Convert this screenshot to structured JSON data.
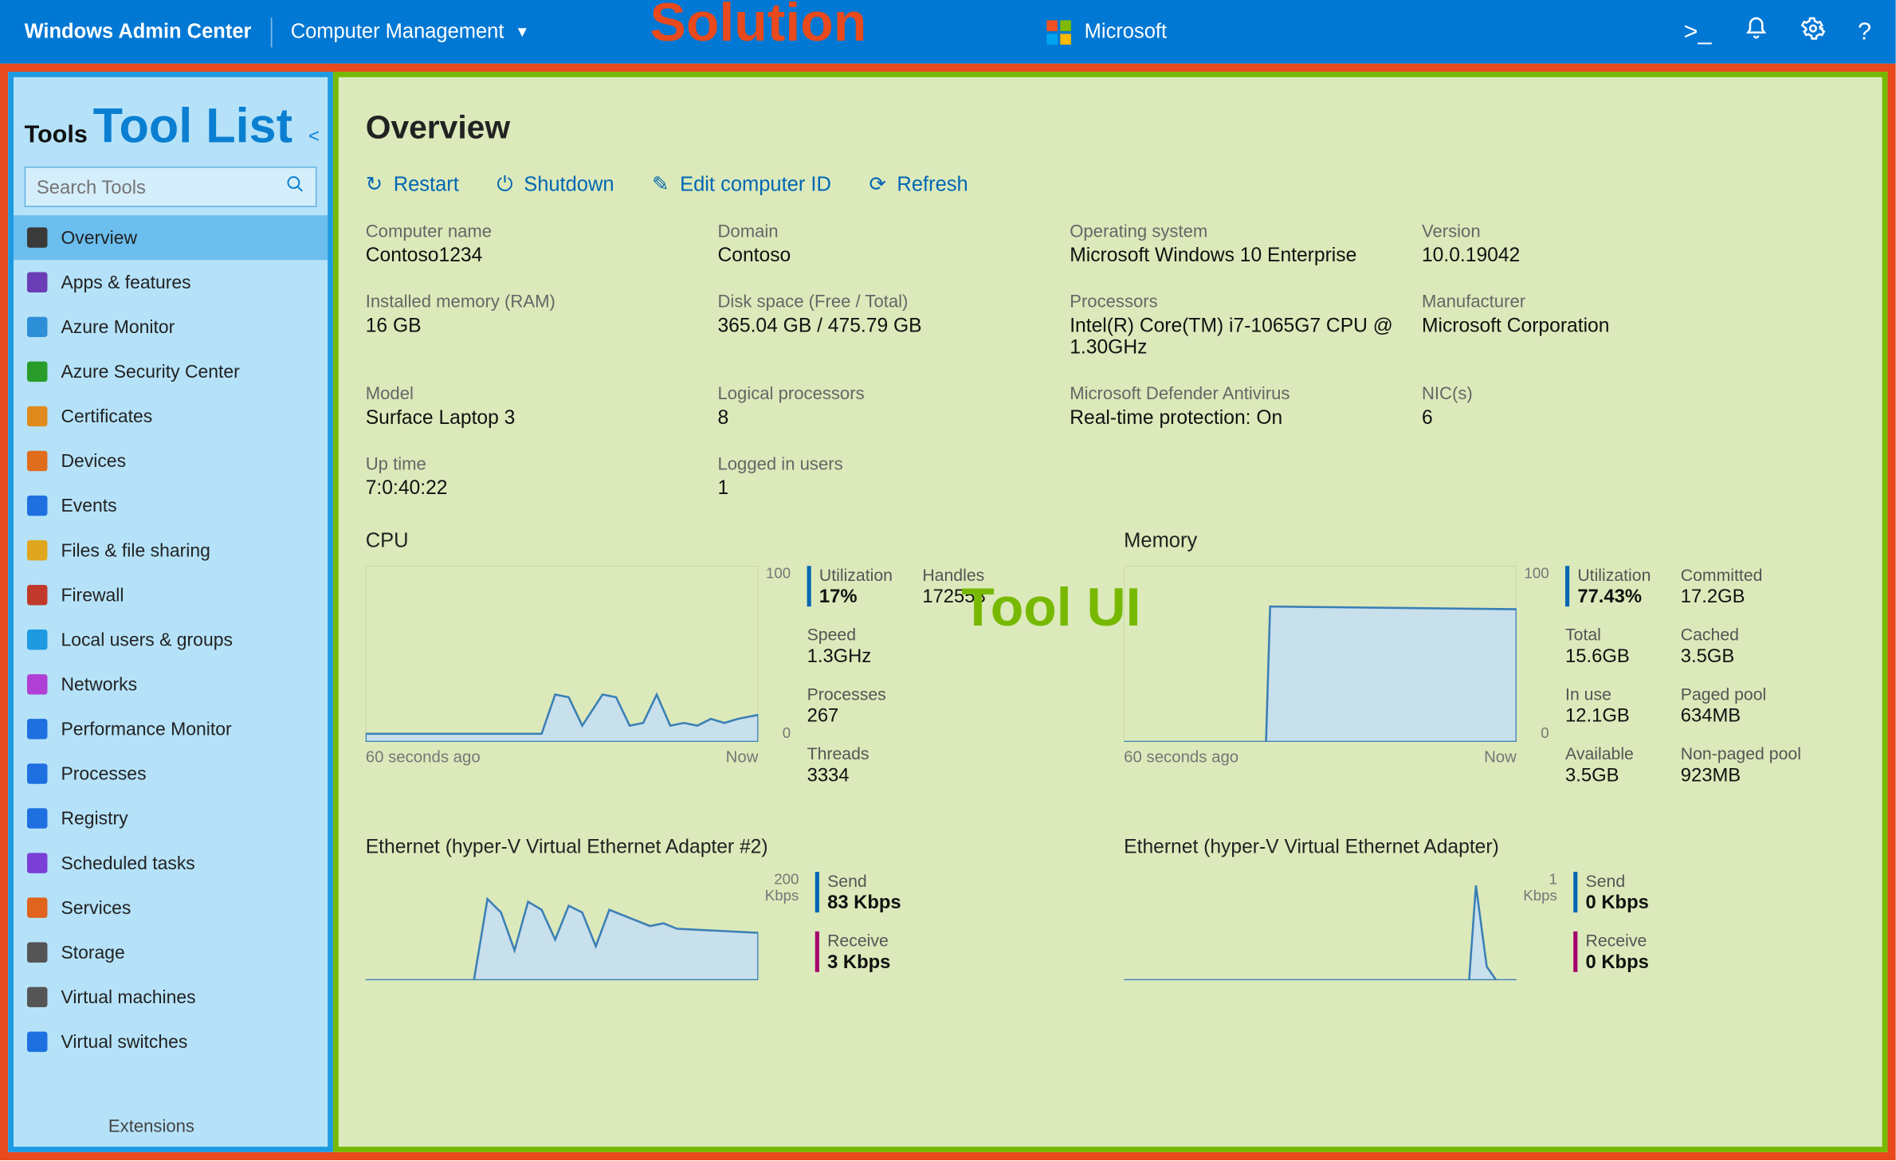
{
  "annotations": {
    "solution_label": "Solution",
    "tool_list_label": "Tool List",
    "tool_ui_label": "Tool UI"
  },
  "topbar": {
    "brand": "Windows Admin Center",
    "solution": "Computer Management",
    "ms_label": "Microsoft"
  },
  "sidebar": {
    "tools_label": "Tools",
    "search_placeholder": "Search Tools",
    "extensions_label": "Extensions",
    "items": [
      {
        "label": "Overview",
        "icon": "#3a3a3a",
        "selected": true
      },
      {
        "label": "Apps & features",
        "icon": "#6a3fb5"
      },
      {
        "label": "Azure Monitor",
        "icon": "#2d8fd6"
      },
      {
        "label": "Azure Security Center",
        "icon": "#2a9c2a"
      },
      {
        "label": "Certificates",
        "icon": "#e08a1e"
      },
      {
        "label": "Devices",
        "icon": "#e06c1e"
      },
      {
        "label": "Events",
        "icon": "#1e70e0"
      },
      {
        "label": "Files & file sharing",
        "icon": "#e0a71e"
      },
      {
        "label": "Firewall",
        "icon": "#c0392b"
      },
      {
        "label": "Local users & groups",
        "icon": "#1e9ae0"
      },
      {
        "label": "Networks",
        "icon": "#b03fd6"
      },
      {
        "label": "Performance Monitor",
        "icon": "#1e70e0"
      },
      {
        "label": "Processes",
        "icon": "#1e70e0"
      },
      {
        "label": "Registry",
        "icon": "#1e70e0"
      },
      {
        "label": "Scheduled tasks",
        "icon": "#7a3fd6"
      },
      {
        "label": "Services",
        "icon": "#e0641e"
      },
      {
        "label": "Storage",
        "icon": "#555"
      },
      {
        "label": "Virtual machines",
        "icon": "#555"
      },
      {
        "label": "Virtual switches",
        "icon": "#1e70e0"
      }
    ]
  },
  "overview": {
    "title": "Overview",
    "actions": {
      "restart": "Restart",
      "shutdown": "Shutdown",
      "edit_id": "Edit computer ID",
      "refresh": "Refresh"
    },
    "fields": {
      "computer_name": {
        "label": "Computer name",
        "value": "Contoso1234"
      },
      "domain": {
        "label": "Domain",
        "value": "Contoso"
      },
      "os": {
        "label": "Operating system",
        "value": "Microsoft Windows 10 Enterprise"
      },
      "version": {
        "label": "Version",
        "value": "10.0.19042"
      },
      "ram": {
        "label": "Installed memory (RAM)",
        "value": "16 GB"
      },
      "disk": {
        "label": "Disk space (Free / Total)",
        "value": "365.04 GB / 475.79 GB"
      },
      "processors": {
        "label": "Processors",
        "value": "Intel(R) Core(TM) i7-1065G7 CPU @ 1.30GHz"
      },
      "manufacturer": {
        "label": "Manufacturer",
        "value": "Microsoft Corporation"
      },
      "model": {
        "label": "Model",
        "value": "Surface Laptop 3"
      },
      "logical": {
        "label": "Logical processors",
        "value": "8"
      },
      "defender": {
        "label": "Microsoft Defender Antivirus",
        "value": "Real-time protection: On"
      },
      "nics": {
        "label": "NIC(s)",
        "value": "6"
      },
      "uptime": {
        "label": "Up time",
        "value": "7:0:40:22"
      },
      "logged_in": {
        "label": "Logged in users",
        "value": "1"
      }
    }
  },
  "cpu": {
    "title": "CPU",
    "y_max": "100",
    "y_min": "0",
    "time_start": "60 seconds ago",
    "time_end": "Now",
    "utilization": {
      "label": "Utilization",
      "value": "17%"
    },
    "handles": {
      "label": "Handles",
      "value": "172553"
    },
    "speed": {
      "label": "Speed",
      "value": "1.3GHz"
    },
    "processes": {
      "label": "Processes",
      "value": "267"
    },
    "threads": {
      "label": "Threads",
      "value": "3334"
    }
  },
  "memory": {
    "title": "Memory",
    "y_max": "100",
    "y_min": "0",
    "time_start": "60 seconds ago",
    "time_end": "Now",
    "utilization": {
      "label": "Utilization",
      "value": "77.43%"
    },
    "committed": {
      "label": "Committed",
      "value": "17.2GB"
    },
    "total": {
      "label": "Total",
      "value": "15.6GB"
    },
    "cached": {
      "label": "Cached",
      "value": "3.5GB"
    },
    "inuse": {
      "label": "In use",
      "value": "12.1GB"
    },
    "paged": {
      "label": "Paged pool",
      "value": "634MB"
    },
    "available": {
      "label": "Available",
      "value": "3.5GB"
    },
    "nonpaged": {
      "label": "Non-paged pool",
      "value": "923MB"
    }
  },
  "eth1": {
    "title": "Ethernet (hyper-V Virtual Ethernet Adapter #2)",
    "axis": "200 Kbps",
    "send": {
      "label": "Send",
      "value": "83 Kbps"
    },
    "receive": {
      "label": "Receive",
      "value": "3 Kbps"
    }
  },
  "eth2": {
    "title": "Ethernet (hyper-V Virtual Ethernet Adapter)",
    "axis": "1 Kbps",
    "send": {
      "label": "Send",
      "value": "0 Kbps"
    },
    "receive": {
      "label": "Receive",
      "value": "0 Kbps"
    }
  },
  "chart_data": [
    {
      "type": "line",
      "title": "CPU",
      "ylabel": "Utilization %",
      "ylim": [
        0,
        100
      ],
      "x": [
        "-60s",
        "Now"
      ],
      "series": [
        {
          "name": "CPU Utilization",
          "values": [
            5,
            5,
            5,
            5,
            5,
            5,
            5,
            5,
            5,
            5,
            5,
            5,
            5,
            5,
            5,
            30,
            28,
            10,
            30,
            28,
            10,
            12,
            28,
            10,
            12,
            10,
            14,
            12,
            14,
            16
          ]
        }
      ]
    },
    {
      "type": "line",
      "title": "Memory",
      "ylabel": "Utilization %",
      "ylim": [
        0,
        100
      ],
      "x": [
        "-60s",
        "Now"
      ],
      "series": [
        {
          "name": "Memory Utilization",
          "values": [
            0,
            0,
            0,
            0,
            0,
            77,
            77,
            77,
            77,
            77,
            77,
            77,
            77,
            77,
            77,
            77,
            77,
            77,
            77,
            77,
            77,
            77,
            77,
            77,
            77,
            77,
            77,
            77,
            77,
            77
          ]
        }
      ]
    },
    {
      "type": "line",
      "title": "Ethernet (hyper-V Virtual Ethernet Adapter #2)",
      "ylabel": "Kbps",
      "ylim": [
        0,
        200
      ],
      "x": [
        "-60s",
        "Now"
      ],
      "series": [
        {
          "name": "Send",
          "values": [
            0,
            0,
            0,
            0,
            0,
            140,
            110,
            60,
            140,
            130,
            80,
            130,
            120,
            70,
            120,
            110,
            100,
            90,
            95,
            83
          ]
        },
        {
          "name": "Receive",
          "values": [
            0,
            0,
            0,
            0,
            0,
            5,
            3,
            3,
            4,
            3,
            3,
            4,
            3,
            3,
            3,
            3,
            3,
            3,
            3,
            3
          ]
        }
      ]
    },
    {
      "type": "line",
      "title": "Ethernet (hyper-V Virtual Ethernet Adapter)",
      "ylabel": "Kbps",
      "ylim": [
        0,
        1
      ],
      "x": [
        "-60s",
        "Now"
      ],
      "series": [
        {
          "name": "Send",
          "values": [
            0,
            0,
            0,
            0,
            0,
            0,
            0,
            0,
            0,
            0,
            0,
            0,
            0,
            0,
            0,
            0,
            0,
            0.9,
            0.1,
            0
          ]
        },
        {
          "name": "Receive",
          "values": [
            0,
            0,
            0,
            0,
            0,
            0,
            0,
            0,
            0,
            0,
            0,
            0,
            0,
            0,
            0,
            0,
            0,
            0,
            0,
            0
          ]
        }
      ]
    }
  ]
}
